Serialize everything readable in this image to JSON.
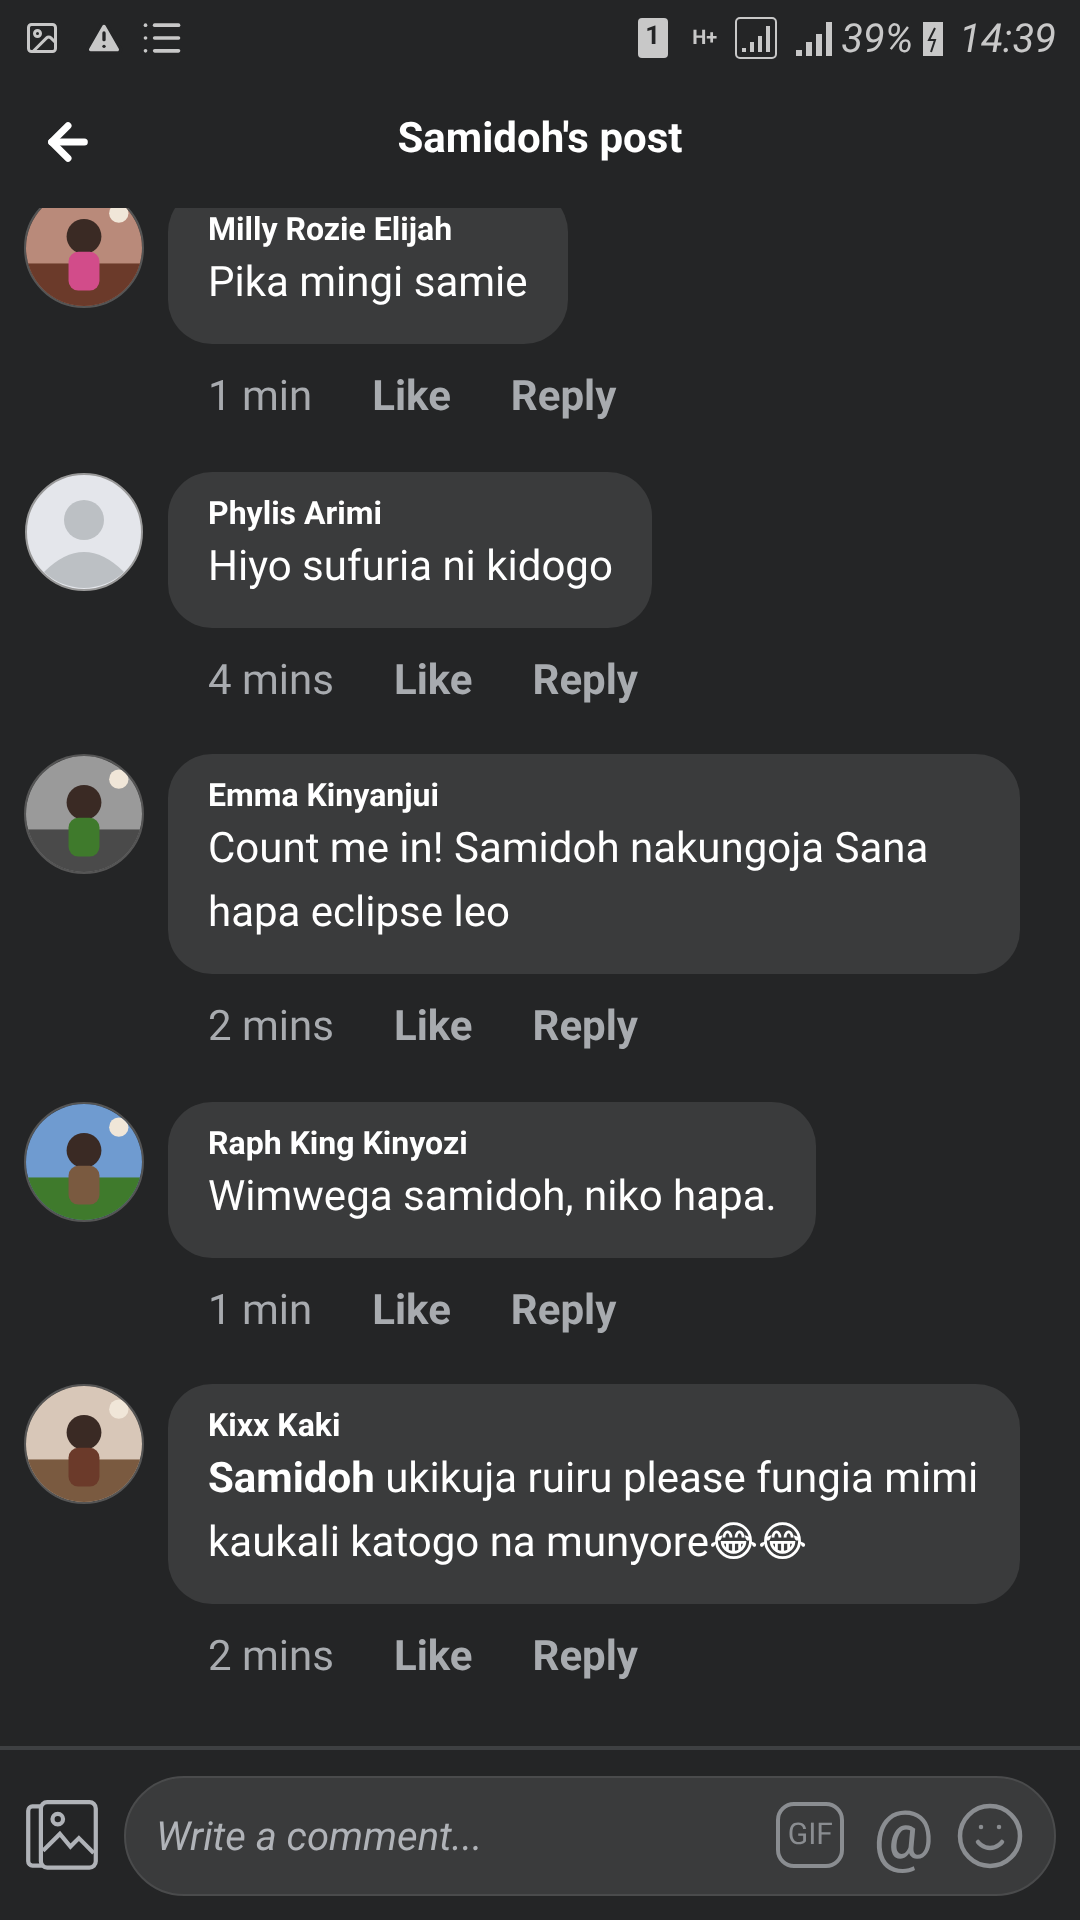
{
  "status_bar": {
    "sim": "1",
    "network": "H+",
    "battery": "39%",
    "time": "14:39"
  },
  "header": {
    "title": "Samidoh's post"
  },
  "comments": [
    {
      "kind": "picture",
      "name": "Milly Rozie Elijah",
      "text": "Pika mingi samie",
      "time": "1 min",
      "like": "Like",
      "reply": "Reply"
    },
    {
      "kind": "default",
      "name": "Phylis Arimi",
      "text": "Hiyo sufuria ni kidogo",
      "time": "4 mins",
      "like": "Like",
      "reply": "Reply"
    },
    {
      "kind": "picture",
      "name": "Emma Kinyanjui",
      "text": "Count me in! Samidoh nakungoja Sana hapa eclipse leo",
      "time": "2 mins",
      "like": "Like",
      "reply": "Reply"
    },
    {
      "kind": "picture",
      "name": "Raph King Kinyozi",
      "text": "Wimwega samidoh, niko hapa.",
      "time": "1 min",
      "like": "Like",
      "reply": "Reply"
    },
    {
      "kind": "picture",
      "name": "Kixx Kaki",
      "text": "**Samidoh**  ukikuja ruiru please fungia mimi kaukali katogo na munyore😂😂",
      "time": "2 mins",
      "like": "Like",
      "reply": "Reply"
    }
  ],
  "composer": {
    "placeholder": "Write a comment...",
    "gif": "GIF",
    "mention": "@"
  }
}
